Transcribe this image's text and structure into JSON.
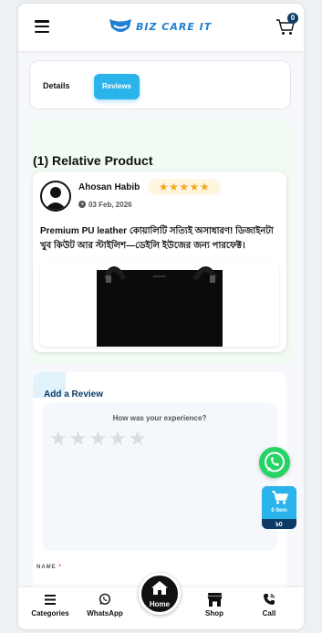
{
  "header": {
    "logo_text": "BIZ CARE IT",
    "cart_count": "0"
  },
  "tabs": [
    {
      "label": "Details",
      "active": false
    },
    {
      "label": "Reviews",
      "active": true
    }
  ],
  "section": {
    "title": "(1) Relative Product"
  },
  "review": {
    "name": "Ahosan Habib",
    "stars": "★★★★★",
    "rating": 5,
    "date": "03 Feb, 2026",
    "text": "Premium PU leather কোয়ালিটি সত্যিই অসাধারণ! ডিজাইনটা খুব কিউট আর স্টাইলিশ—ডেইলি ইউজের জন্য পারফেক্ট।"
  },
  "add_review": {
    "title": "Add a Review",
    "experience_prompt": "How was your experience?",
    "empty_stars": "★★★★★",
    "name_label": "NAME",
    "required_mark": "*"
  },
  "side_cart": {
    "items": "0 item",
    "total": "৳0"
  },
  "bottom_nav": {
    "categories": "Categories",
    "whatsapp": "WhatsApp",
    "home": "Home",
    "shop": "Shop",
    "call": "Call"
  },
  "colors": {
    "accent": "#2bb3ec",
    "navy": "#0d3b66",
    "star": "#f5a623",
    "whatsapp": "#25d366"
  }
}
